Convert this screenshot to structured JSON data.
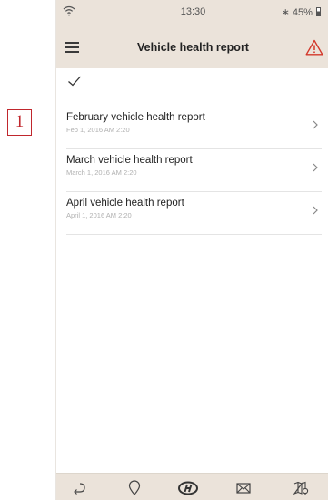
{
  "annotation": {
    "number": "1"
  },
  "status_bar": {
    "time": "13:30",
    "battery": "45%"
  },
  "header": {
    "title": "Vehicle health report"
  },
  "reports": [
    {
      "title": "February vehicle health report",
      "date": "Feb 1, 2016 AM 2:20"
    },
    {
      "title": "March vehicle health report",
      "date": "March 1, 2016 AM 2:20"
    },
    {
      "title": "April vehicle health report",
      "date": "April 1, 2016 AM 2:20"
    }
  ],
  "bottom_nav": [
    "return-icon",
    "location-pin-icon",
    "hyundai-logo-icon",
    "mail-icon",
    "map-icon"
  ],
  "colors": {
    "bar_bg": "#ebe3da",
    "warning": "#d3382b",
    "callout": "#c0272d"
  }
}
